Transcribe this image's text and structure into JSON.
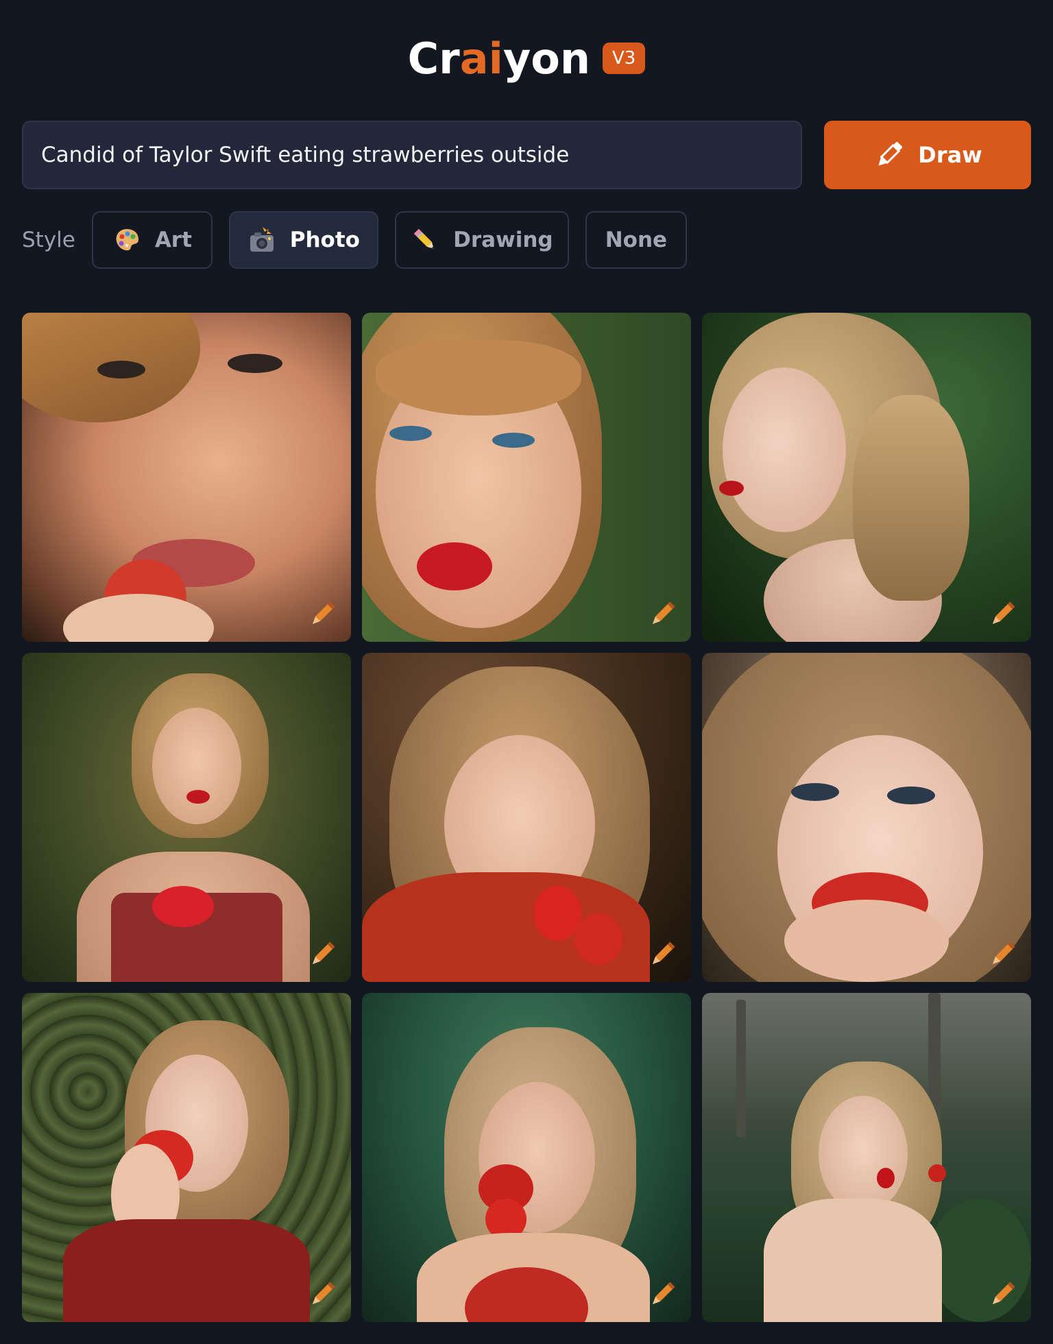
{
  "header": {
    "logo_prefix": "Cr",
    "logo_accent": "ai",
    "logo_suffix": "yon",
    "version": "V3",
    "accent_color": "#d9591a"
  },
  "prompt": {
    "value": "Candid of Taylor Swift eating strawberries outside"
  },
  "draw_button": {
    "label": "Draw",
    "icon": "pencil-icon"
  },
  "styles": {
    "label": "Style",
    "options": [
      {
        "label": "Art",
        "icon": "palette-icon",
        "selected": false
      },
      {
        "label": "Photo",
        "icon": "camera-flash-icon",
        "selected": true
      },
      {
        "label": "Drawing",
        "icon": "pencil-icon",
        "selected": false
      },
      {
        "label": "None",
        "icon": "",
        "selected": false
      }
    ]
  },
  "results": {
    "count": 9,
    "tile_action_icon": "pencil-edit-icon"
  }
}
